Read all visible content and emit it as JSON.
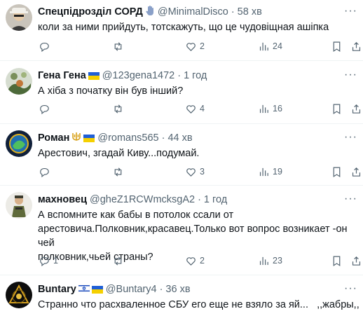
{
  "posts": [
    {
      "name": "Спецпідрозділ СОРД",
      "handle": "@MinimalDisco",
      "time": "58 хв",
      "text": "коли за ними прийдуть, тотскажуть, що це чудовіщная ашіпка",
      "likes": "2",
      "views": "24",
      "replies": "",
      "reposts": "",
      "badges": [
        "hand-icon"
      ]
    },
    {
      "name": "Гена Гена",
      "handle": "@123gena1472",
      "time": "1 год",
      "text": "А хіба з початку він був інший?",
      "likes": "4",
      "views": "16",
      "replies": "",
      "reposts": "",
      "badges": [
        "ukraine-flag"
      ]
    },
    {
      "name": "Роман",
      "handle": "@romans565",
      "time": "44 хв",
      "text": "Арестович, згадай Киву...подумай.",
      "likes": "3",
      "views": "19",
      "replies": "",
      "reposts": "",
      "badges": [
        "trident-icon",
        "ukraine-flag"
      ]
    },
    {
      "name": "махновец",
      "handle": "@gheZ1RCWmcksgA2",
      "time": "1 год",
      "text_lines": [
        "А вспомните как бабы в потолок ссали от",
        "арестовича.Полковник,красавец.Только вот вопрос возникает -он чей",
        "полковник,чьей страны?"
      ],
      "replies": "1",
      "likes": "2",
      "views": "23",
      "reposts": "",
      "badges": []
    },
    {
      "name": "Buntary",
      "handle": "@Buntary4",
      "time": "36 хв",
      "text": "Странно что расхваленное СБУ его еще не взяло за яй...   ,,жабры,,",
      "badges": [
        "israel-flag",
        "ukraine-flag"
      ]
    }
  ],
  "more_label": "···",
  "colors": {
    "text": "#0f1419",
    "secondary": "#536471",
    "divider": "#eff3f4"
  }
}
